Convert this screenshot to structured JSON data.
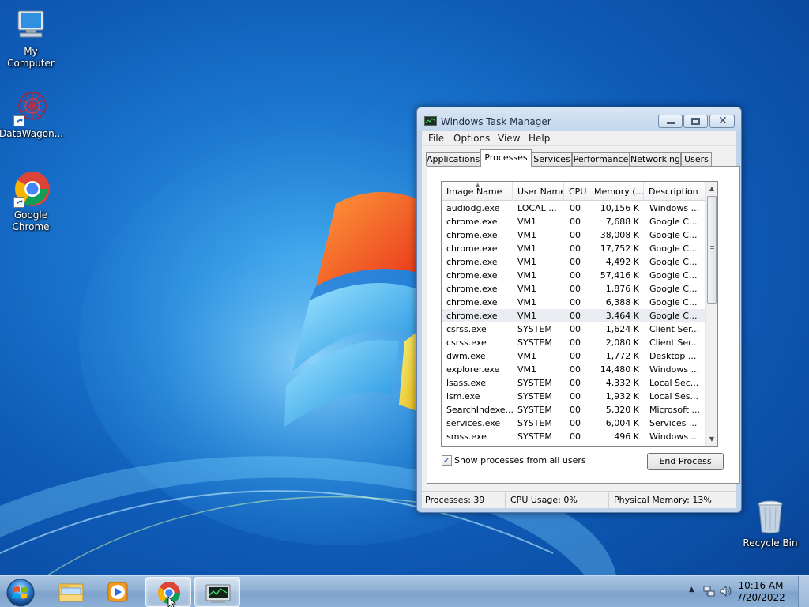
{
  "desktop": {
    "icons": [
      {
        "label": "My Computer"
      },
      {
        "label": "DataWagon..."
      },
      {
        "label": "Google Chrome"
      },
      {
        "label": "Recycle Bin"
      }
    ]
  },
  "window": {
    "title": "Windows Task Manager",
    "menu": [
      "File",
      "Options",
      "View",
      "Help"
    ],
    "tabs": [
      "Applications",
      "Processes",
      "Services",
      "Performance",
      "Networking",
      "Users"
    ],
    "selected_tab": "Processes",
    "columns": [
      "Image Name",
      "User Name",
      "CPU",
      "Memory (...",
      "Description"
    ],
    "rows": [
      {
        "image": "audiodg.exe",
        "user": "LOCAL ...",
        "cpu": "00",
        "mem": "10,156 K",
        "desc": "Windows ..."
      },
      {
        "image": "chrome.exe",
        "user": "VM1",
        "cpu": "00",
        "mem": "7,688 K",
        "desc": "Google C..."
      },
      {
        "image": "chrome.exe",
        "user": "VM1",
        "cpu": "00",
        "mem": "38,008 K",
        "desc": "Google C..."
      },
      {
        "image": "chrome.exe",
        "user": "VM1",
        "cpu": "00",
        "mem": "17,752 K",
        "desc": "Google C..."
      },
      {
        "image": "chrome.exe",
        "user": "VM1",
        "cpu": "00",
        "mem": "4,492 K",
        "desc": "Google C..."
      },
      {
        "image": "chrome.exe",
        "user": "VM1",
        "cpu": "00",
        "mem": "57,416 K",
        "desc": "Google C..."
      },
      {
        "image": "chrome.exe",
        "user": "VM1",
        "cpu": "00",
        "mem": "1,876 K",
        "desc": "Google C..."
      },
      {
        "image": "chrome.exe",
        "user": "VM1",
        "cpu": "00",
        "mem": "6,388 K",
        "desc": "Google C..."
      },
      {
        "image": "chrome.exe",
        "user": "VM1",
        "cpu": "00",
        "mem": "3,464 K",
        "desc": "Google C..."
      },
      {
        "image": "csrss.exe",
        "user": "SYSTEM",
        "cpu": "00",
        "mem": "1,624 K",
        "desc": "Client Ser..."
      },
      {
        "image": "csrss.exe",
        "user": "SYSTEM",
        "cpu": "00",
        "mem": "2,080 K",
        "desc": "Client Ser..."
      },
      {
        "image": "dwm.exe",
        "user": "VM1",
        "cpu": "00",
        "mem": "1,772 K",
        "desc": "Desktop ..."
      },
      {
        "image": "explorer.exe",
        "user": "VM1",
        "cpu": "00",
        "mem": "14,480 K",
        "desc": "Windows ..."
      },
      {
        "image": "lsass.exe",
        "user": "SYSTEM",
        "cpu": "00",
        "mem": "4,332 K",
        "desc": "Local Sec..."
      },
      {
        "image": "lsm.exe",
        "user": "SYSTEM",
        "cpu": "00",
        "mem": "1,932 K",
        "desc": "Local Ses..."
      },
      {
        "image": "SearchIndexe...",
        "user": "SYSTEM",
        "cpu": "00",
        "mem": "5,320 K",
        "desc": "Microsoft ..."
      },
      {
        "image": "services.exe",
        "user": "SYSTEM",
        "cpu": "00",
        "mem": "6,004 K",
        "desc": "Services ..."
      },
      {
        "image": "smss.exe",
        "user": "SYSTEM",
        "cpu": "00",
        "mem": "496 K",
        "desc": "Windows ..."
      }
    ],
    "highlighted_row": 8,
    "show_all_label": "Show processes from all users",
    "show_all_checked": true,
    "end_process_label": "End Process",
    "status": {
      "processes": "Processes: 39",
      "cpu": "CPU Usage: 0%",
      "memory": "Physical Memory: 13%"
    }
  },
  "taskbar": {
    "time": "10:16 AM",
    "date": "7/20/2022",
    "pinned": [
      "start-orb",
      "windows-explorer",
      "media-player",
      "google-chrome",
      "task-manager"
    ]
  },
  "colors": {
    "desktop_blue": "#0f5cb8",
    "taskbar": "#8fb0d4",
    "window_frame": "#bfd3ea"
  }
}
